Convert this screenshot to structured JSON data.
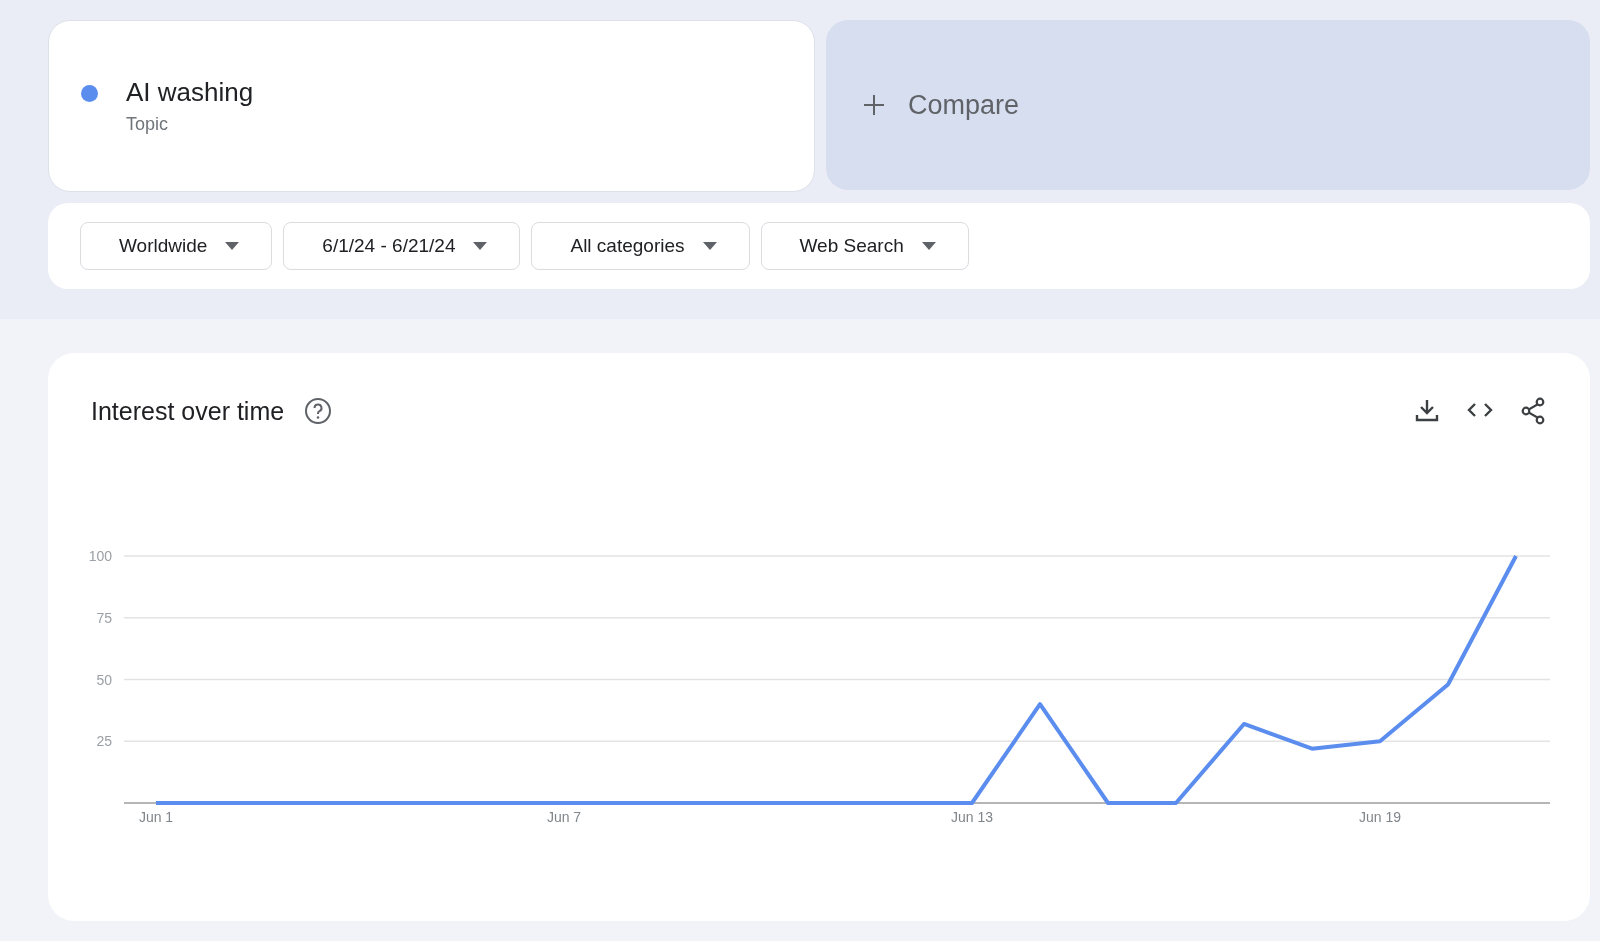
{
  "term": {
    "name": "AI washing",
    "type": "Topic",
    "color": "#5b8def"
  },
  "compare": {
    "label": "Compare"
  },
  "filters": [
    {
      "label": "Worldwide"
    },
    {
      "label": "6/1/24 - 6/21/24"
    },
    {
      "label": "All categories"
    },
    {
      "label": "Web Search"
    }
  ],
  "interest_over_time": {
    "title": "Interest over time",
    "chart_data": {
      "type": "line",
      "categories": [
        "Jun 1",
        null,
        null,
        null,
        null,
        null,
        "Jun 7",
        null,
        null,
        null,
        null,
        null,
        "Jun 13",
        null,
        null,
        null,
        null,
        null,
        "Jun 19",
        null,
        null
      ],
      "grid": true,
      "series": [
        {
          "color": "#5b8def",
          "values": [
            0,
            0,
            0,
            0,
            0,
            0,
            0,
            0,
            0,
            0,
            0,
            0,
            0,
            40,
            0,
            0,
            32,
            22,
            25,
            48,
            100
          ]
        }
      ],
      "ylim": [
        0,
        100
      ],
      "yticks": [
        25,
        50,
        75,
        100
      ]
    }
  }
}
